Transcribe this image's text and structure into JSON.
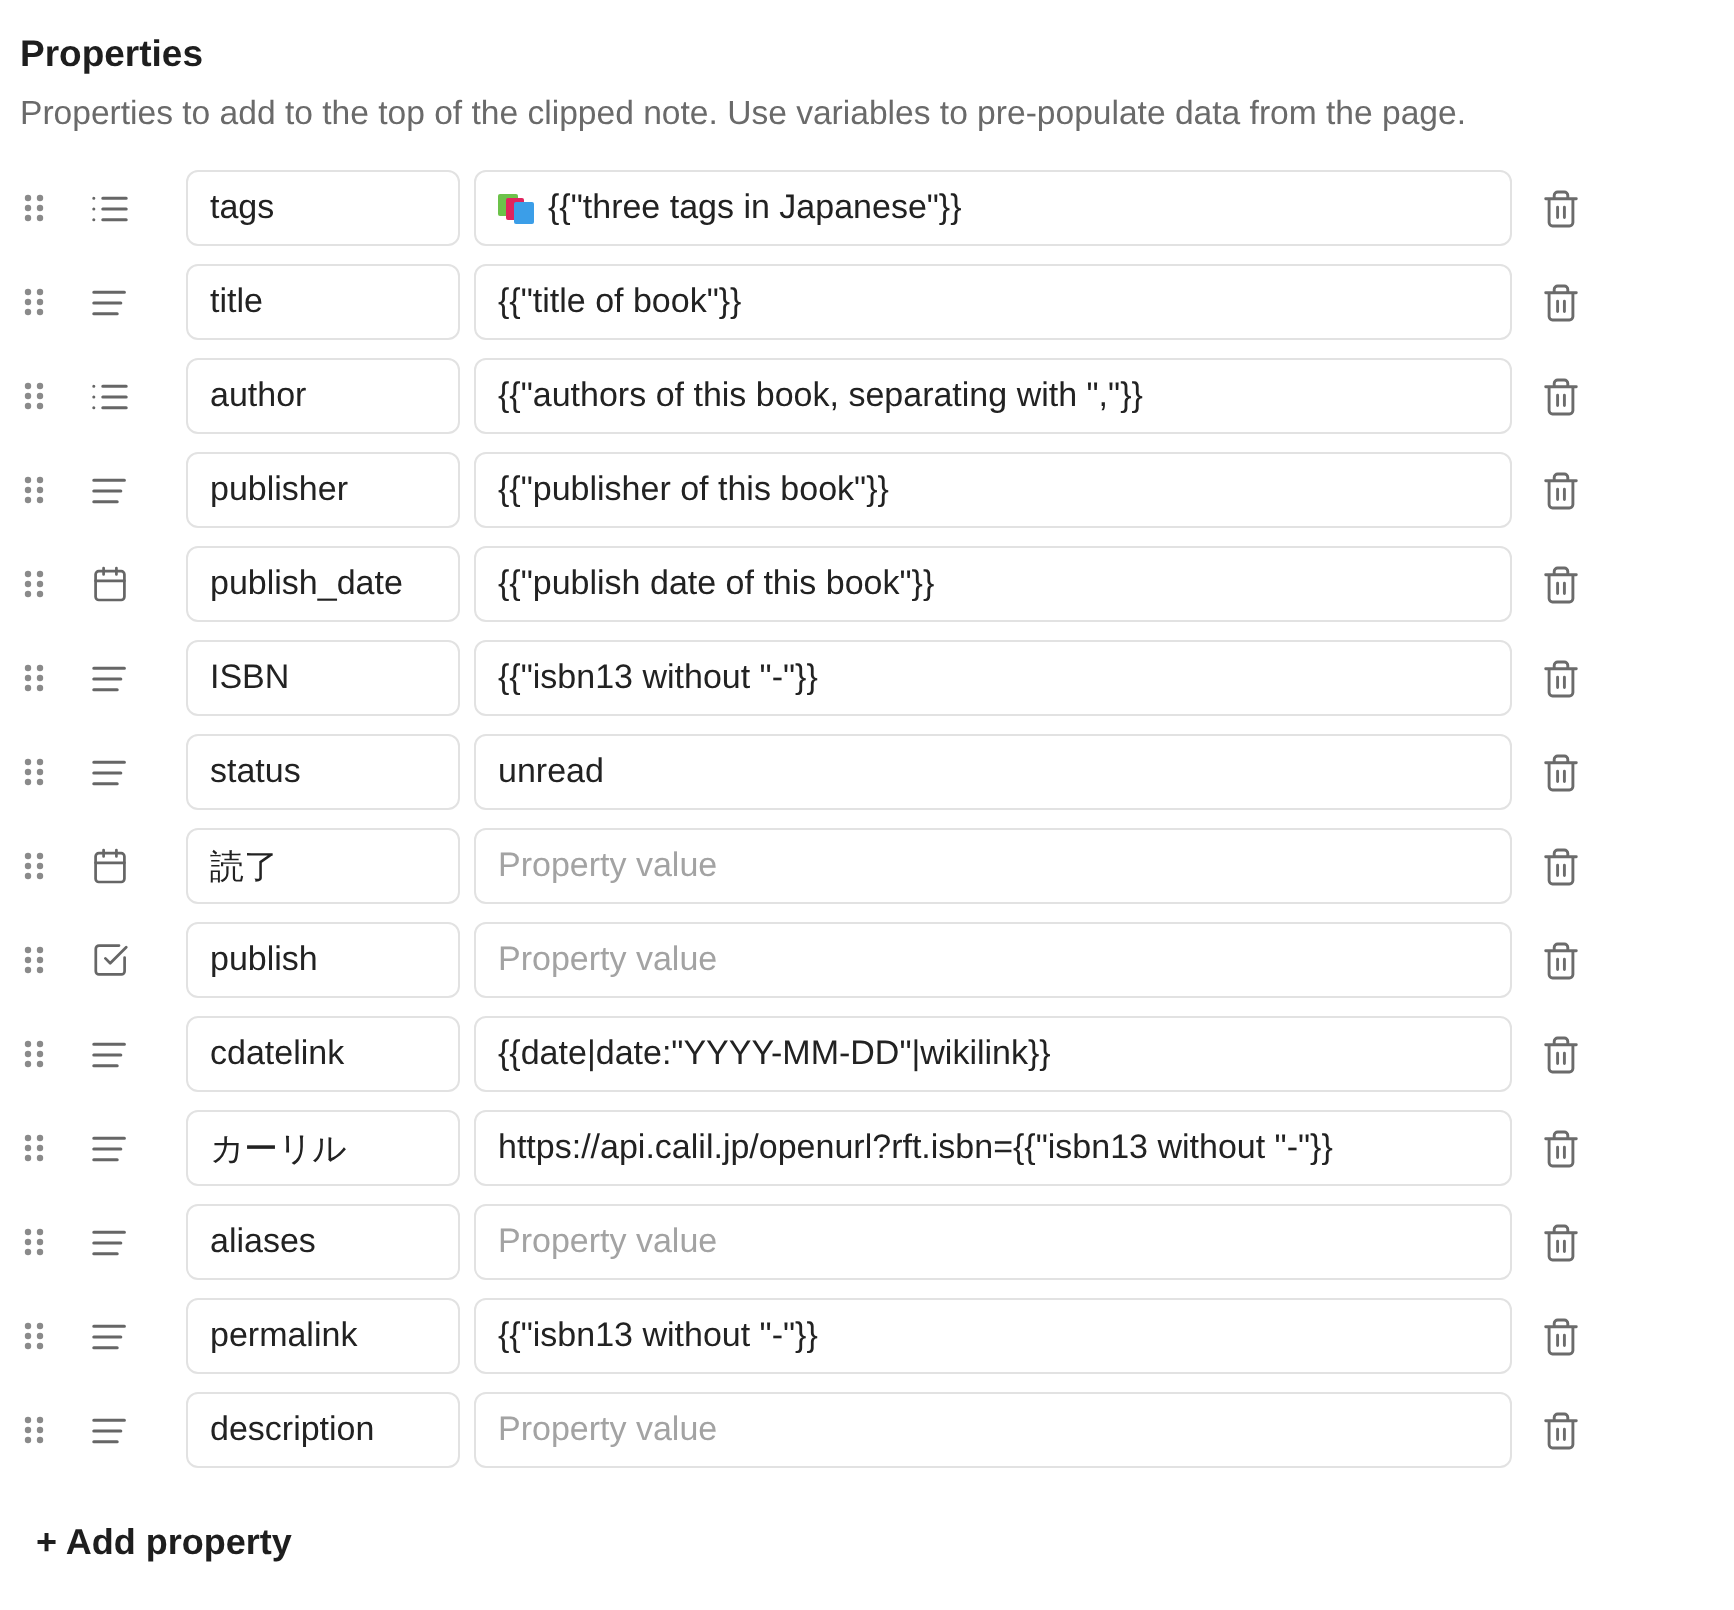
{
  "section": {
    "title": "Properties",
    "description": "Properties to add to the top of the clipped note. Use variables to pre-populate data from the page."
  },
  "properties": [
    {
      "kind": "list",
      "name": "tags",
      "value": "{{\"three tags in Japanese\"}}",
      "emoji": true
    },
    {
      "kind": "text",
      "name": "title",
      "value": "{{\"title of book\"}}",
      "emoji": false
    },
    {
      "kind": "list",
      "name": "author",
      "value": "{{\"authors of this book, separating with \",\"}}",
      "emoji": false
    },
    {
      "kind": "text",
      "name": "publisher",
      "value": "{{\"publisher of this book\"}}",
      "emoji": false
    },
    {
      "kind": "date",
      "name": "publish_date",
      "value": "{{\"publish date of this book\"}}",
      "emoji": false
    },
    {
      "kind": "text",
      "name": "ISBN",
      "value": "{{\"isbn13 without \"-\"}}",
      "emoji": false
    },
    {
      "kind": "text",
      "name": "status",
      "value": "unread",
      "emoji": false
    },
    {
      "kind": "date",
      "name": "読了",
      "placeholder": "Property value",
      "emoji": false
    },
    {
      "kind": "checkbox",
      "name": "publish",
      "placeholder": "Property value",
      "emoji": false
    },
    {
      "kind": "text",
      "name": "cdatelink",
      "value": "{{date|date:\"YYYY-MM-DD\"|wikilink}}",
      "emoji": false
    },
    {
      "kind": "text",
      "name": "カーリル",
      "value": "https://api.calil.jp/openurl?rft.isbn={{\"isbn13 without \"-\"}}",
      "emoji": false
    },
    {
      "kind": "text",
      "name": "aliases",
      "placeholder": "Property value",
      "emoji": false
    },
    {
      "kind": "text",
      "name": "permalink",
      "value": "{{\"isbn13 without \"-\"}}",
      "emoji": false
    },
    {
      "kind": "text",
      "name": "description",
      "placeholder": "Property value",
      "emoji": false
    }
  ],
  "add_button": {
    "label": "+ Add property"
  }
}
